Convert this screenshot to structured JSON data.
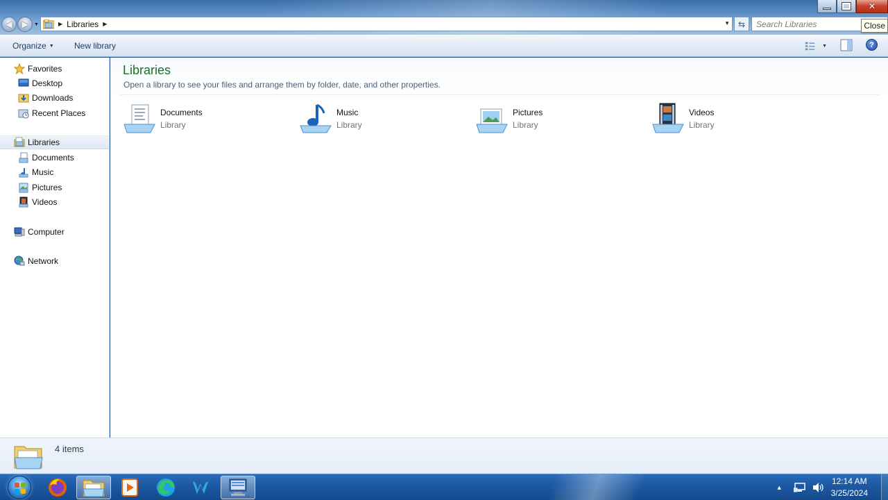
{
  "window": {
    "close_tooltip": "Close"
  },
  "address": {
    "crumbs": [
      "Libraries"
    ],
    "search_placeholder": "Search Libraries"
  },
  "toolbar": {
    "organize_label": "Organize",
    "new_library_label": "New library"
  },
  "navpane": {
    "favorites": {
      "label": "Favorites",
      "items": [
        "Desktop",
        "Downloads",
        "Recent Places"
      ]
    },
    "libraries": {
      "label": "Libraries",
      "items": [
        "Documents",
        "Music",
        "Pictures",
        "Videos"
      ]
    },
    "computer": {
      "label": "Computer"
    },
    "network": {
      "label": "Network"
    }
  },
  "content": {
    "title": "Libraries",
    "description": "Open a library to see your files and arrange them by folder, date, and other properties.",
    "libraries": [
      {
        "name": "Documents",
        "type": "Library",
        "icon": "documents-library-icon"
      },
      {
        "name": "Music",
        "type": "Library",
        "icon": "music-library-icon"
      },
      {
        "name": "Pictures",
        "type": "Library",
        "icon": "pictures-library-icon"
      },
      {
        "name": "Videos",
        "type": "Library",
        "icon": "videos-library-icon"
      }
    ]
  },
  "details": {
    "item_count": "4 items"
  },
  "taskbar": {
    "apps": [
      "firefox-icon",
      "windows-explorer-icon",
      "media-player-icon",
      "edge-icon",
      "wing-ide-icon",
      "remote-desktop-icon"
    ],
    "clock_time": "12:14 AM",
    "clock_date": "3/25/2024"
  },
  "colors": {
    "title_green": "#1e6e2b",
    "taskbar_blue": "#1d5aa5",
    "close_red": "#c7402a"
  }
}
